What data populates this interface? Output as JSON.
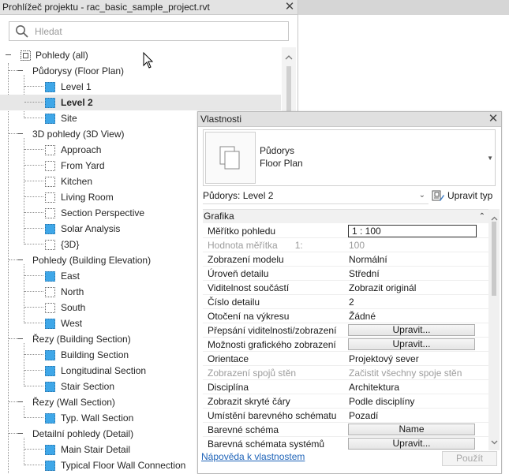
{
  "project_browser": {
    "title": "Prohlížeč projektu - rac_basic_sample_project.rvt",
    "search_placeholder": "Hledat",
    "tree": [
      {
        "label": "Pohledy (all)",
        "level": 0,
        "kind": "root"
      },
      {
        "label": "Půdorysy (Floor Plan)",
        "level": 1,
        "kind": "group"
      },
      {
        "label": "Level 1",
        "level": 2,
        "kind": "view",
        "icon": "filled"
      },
      {
        "label": "Level 2",
        "level": 2,
        "kind": "view",
        "icon": "filled",
        "selected": true
      },
      {
        "label": "Site",
        "level": 2,
        "kind": "view",
        "icon": "filled"
      },
      {
        "label": "3D pohledy (3D View)",
        "level": 1,
        "kind": "group"
      },
      {
        "label": "Approach",
        "level": 2,
        "kind": "view",
        "icon": "empty"
      },
      {
        "label": "From Yard",
        "level": 2,
        "kind": "view",
        "icon": "empty"
      },
      {
        "label": "Kitchen",
        "level": 2,
        "kind": "view",
        "icon": "empty"
      },
      {
        "label": "Living Room",
        "level": 2,
        "kind": "view",
        "icon": "empty"
      },
      {
        "label": "Section Perspective",
        "level": 2,
        "kind": "view",
        "icon": "empty"
      },
      {
        "label": "Solar Analysis",
        "level": 2,
        "kind": "view",
        "icon": "filled"
      },
      {
        "label": "{3D}",
        "level": 2,
        "kind": "view",
        "icon": "empty"
      },
      {
        "label": "Pohledy (Building Elevation)",
        "level": 1,
        "kind": "group"
      },
      {
        "label": "East",
        "level": 2,
        "kind": "view",
        "icon": "filled"
      },
      {
        "label": "North",
        "level": 2,
        "kind": "view",
        "icon": "empty"
      },
      {
        "label": "South",
        "level": 2,
        "kind": "view",
        "icon": "empty"
      },
      {
        "label": "West",
        "level": 2,
        "kind": "view",
        "icon": "filled"
      },
      {
        "label": "Řezy (Building Section)",
        "level": 1,
        "kind": "group"
      },
      {
        "label": "Building Section",
        "level": 2,
        "kind": "view",
        "icon": "filled"
      },
      {
        "label": "Longitudinal Section",
        "level": 2,
        "kind": "view",
        "icon": "filled"
      },
      {
        "label": "Stair Section",
        "level": 2,
        "kind": "view",
        "icon": "filled"
      },
      {
        "label": "Řezy (Wall Section)",
        "level": 1,
        "kind": "group"
      },
      {
        "label": "Typ. Wall Section",
        "level": 2,
        "kind": "view",
        "icon": "filled"
      },
      {
        "label": "Detailní pohledy (Detail)",
        "level": 1,
        "kind": "group"
      },
      {
        "label": "Main Stair Detail",
        "level": 2,
        "kind": "view",
        "icon": "filled"
      },
      {
        "label": "Typical Floor Wall Connection",
        "level": 2,
        "kind": "view",
        "icon": "filled"
      }
    ]
  },
  "properties": {
    "title": "Vlastnosti",
    "type_name_line1": "Půdorys",
    "type_name_line2": "Floor Plan",
    "instance_selector": "Půdorys: Level 2",
    "edit_type_label": "Upravit typ",
    "category": "Grafika",
    "rows": [
      {
        "name": "Měřítko pohledu",
        "value": "1 : 100",
        "kind": "input"
      },
      {
        "name": "Hodnota měřítka",
        "extra": "1:",
        "value": "100",
        "kind": "grey"
      },
      {
        "name": "Zobrazení modelu",
        "value": "Normální",
        "kind": "text"
      },
      {
        "name": "Úroveň detailu",
        "value": "Střední",
        "kind": "text"
      },
      {
        "name": "Viditelnost součástí",
        "value": "Zobrazit originál",
        "kind": "text"
      },
      {
        "name": "Číslo detailu",
        "value": "2",
        "kind": "text"
      },
      {
        "name": "Otočení na výkresu",
        "value": "Žádné",
        "kind": "text"
      },
      {
        "name": "Přepsání viditelnosti/zobrazení",
        "value": "Upravit...",
        "kind": "button"
      },
      {
        "name": "Možnosti grafického zobrazení",
        "value": "Upravit...",
        "kind": "button"
      },
      {
        "name": "Orientace",
        "value": "Projektový sever",
        "kind": "text"
      },
      {
        "name": "Zobrazení spojů stěn",
        "value": "Začistit všechny spoje stěn",
        "kind": "grey"
      },
      {
        "name": "Disciplína",
        "value": "Architektura",
        "kind": "text"
      },
      {
        "name": "Zobrazit skryté čáry",
        "value": "Podle disciplíny",
        "kind": "text"
      },
      {
        "name": "Umístění barevného schématu",
        "value": "Pozadí",
        "kind": "text"
      },
      {
        "name": "Barevné schéma",
        "value": "Name",
        "kind": "button"
      },
      {
        "name": "Barevná schémata systémů",
        "value": "Upravit...",
        "kind": "button"
      }
    ],
    "help_link": "Nápověda k vlastnostem",
    "apply_label": "Použít"
  }
}
